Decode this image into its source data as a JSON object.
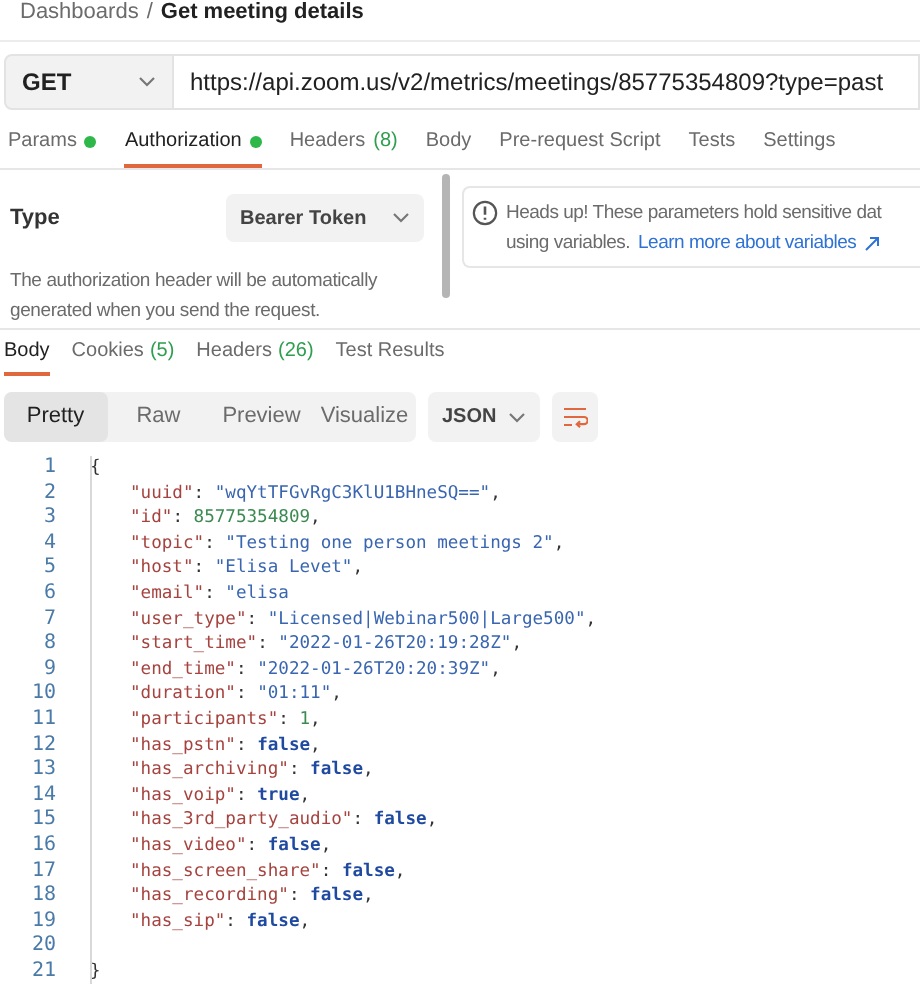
{
  "breadcrumb": {
    "parent": "Dashboards",
    "separator": "/",
    "current": "Get meeting details"
  },
  "request": {
    "method": "GET",
    "url": "https://api.zoom.us/v2/metrics/meetings/85775354809?type=past"
  },
  "request_tabs": [
    {
      "label": "Params",
      "dot": true,
      "selected": false
    },
    {
      "label": "Authorization",
      "dot": true,
      "selected": true
    },
    {
      "label": "Headers",
      "count": "(8)",
      "dot": false,
      "selected": false
    },
    {
      "label": "Body",
      "dot": false,
      "selected": false
    },
    {
      "label": "Pre-request Script",
      "dot": false,
      "selected": false
    },
    {
      "label": "Tests",
      "dot": false,
      "selected": false
    },
    {
      "label": "Settings",
      "dot": false,
      "selected": false
    }
  ],
  "authorization": {
    "type_label": "Type",
    "type_value": "Bearer Token",
    "description": "The authorization header will be automatically generated when you send the request.",
    "notice": "Heads up! These parameters hold sensitive dat",
    "notice_line2": "using variables.",
    "notice_link": "Learn more about variables"
  },
  "response_tabs": [
    {
      "label": "Body",
      "selected": true
    },
    {
      "label": "Cookies",
      "count": "(5)",
      "selected": false
    },
    {
      "label": "Headers",
      "count": "(26)",
      "selected": false
    },
    {
      "label": "Test Results",
      "selected": false
    }
  ],
  "view_modes": [
    {
      "label": "Pretty",
      "selected": true
    },
    {
      "label": "Raw",
      "selected": false
    },
    {
      "label": "Preview",
      "selected": false
    },
    {
      "label": "Visualize",
      "selected": false
    }
  ],
  "format": "JSON",
  "code_lines": [
    {
      "number": "1",
      "tokens": [
        {
          "kind": "punct",
          "text": "{"
        }
      ]
    },
    {
      "number": "2",
      "tokens": [
        {
          "kind": "key",
          "text": "\"uuid\""
        },
        {
          "kind": "punct",
          "text": ": "
        },
        {
          "kind": "string",
          "text": "\"wqYtTFGvRgC3KlU1BHneSQ==\""
        },
        {
          "kind": "punct",
          "text": ","
        }
      ]
    },
    {
      "number": "3",
      "tokens": [
        {
          "kind": "key",
          "text": "\"id\""
        },
        {
          "kind": "punct",
          "text": ": "
        },
        {
          "kind": "number",
          "text": "85775354809"
        },
        {
          "kind": "punct",
          "text": ","
        }
      ]
    },
    {
      "number": "4",
      "tokens": [
        {
          "kind": "key",
          "text": "\"topic\""
        },
        {
          "kind": "punct",
          "text": ": "
        },
        {
          "kind": "string",
          "text": "\"Testing one person meetings 2\""
        },
        {
          "kind": "punct",
          "text": ","
        }
      ]
    },
    {
      "number": "5",
      "tokens": [
        {
          "kind": "key",
          "text": "\"host\""
        },
        {
          "kind": "punct",
          "text": ": "
        },
        {
          "kind": "string",
          "text": "\"Elisa Levet\""
        },
        {
          "kind": "punct",
          "text": ","
        }
      ]
    },
    {
      "number": "6",
      "tokens": [
        {
          "kind": "key",
          "text": "\"email\""
        },
        {
          "kind": "punct",
          "text": ": "
        },
        {
          "kind": "string",
          "text": "\"elisa"
        }
      ]
    },
    {
      "number": "7",
      "tokens": [
        {
          "kind": "key",
          "text": "\"user_type\""
        },
        {
          "kind": "punct",
          "text": ": "
        },
        {
          "kind": "string",
          "text": "\"Licensed|Webinar500|Large500\""
        },
        {
          "kind": "punct",
          "text": ","
        }
      ]
    },
    {
      "number": "8",
      "tokens": [
        {
          "kind": "key",
          "text": "\"start_time\""
        },
        {
          "kind": "punct",
          "text": ": "
        },
        {
          "kind": "string",
          "text": "\"2022-01-26T20:19:28Z\""
        },
        {
          "kind": "punct",
          "text": ","
        }
      ]
    },
    {
      "number": "9",
      "tokens": [
        {
          "kind": "key",
          "text": "\"end_time\""
        },
        {
          "kind": "punct",
          "text": ": "
        },
        {
          "kind": "string",
          "text": "\"2022-01-26T20:20:39Z\""
        },
        {
          "kind": "punct",
          "text": ","
        }
      ]
    },
    {
      "number": "10",
      "tokens": [
        {
          "kind": "key",
          "text": "\"duration\""
        },
        {
          "kind": "punct",
          "text": ": "
        },
        {
          "kind": "string",
          "text": "\"01:11\""
        },
        {
          "kind": "punct",
          "text": ","
        }
      ]
    },
    {
      "number": "11",
      "tokens": [
        {
          "kind": "key",
          "text": "\"participants\""
        },
        {
          "kind": "punct",
          "text": ": "
        },
        {
          "kind": "number",
          "text": "1"
        },
        {
          "kind": "punct",
          "text": ","
        }
      ]
    },
    {
      "number": "12",
      "tokens": [
        {
          "kind": "key",
          "text": "\"has_pstn\""
        },
        {
          "kind": "punct",
          "text": ": "
        },
        {
          "kind": "boolean",
          "text": "false"
        },
        {
          "kind": "punct",
          "text": ","
        }
      ]
    },
    {
      "number": "13",
      "tokens": [
        {
          "kind": "key",
          "text": "\"has_archiving\""
        },
        {
          "kind": "punct",
          "text": ": "
        },
        {
          "kind": "boolean",
          "text": "false"
        },
        {
          "kind": "punct",
          "text": ","
        }
      ]
    },
    {
      "number": "14",
      "tokens": [
        {
          "kind": "key",
          "text": "\"has_voip\""
        },
        {
          "kind": "punct",
          "text": ": "
        },
        {
          "kind": "boolean",
          "text": "true"
        },
        {
          "kind": "punct",
          "text": ","
        }
      ]
    },
    {
      "number": "15",
      "tokens": [
        {
          "kind": "key",
          "text": "\"has_3rd_party_audio\""
        },
        {
          "kind": "punct",
          "text": ": "
        },
        {
          "kind": "boolean",
          "text": "false"
        },
        {
          "kind": "punct",
          "text": ","
        }
      ]
    },
    {
      "number": "16",
      "tokens": [
        {
          "kind": "key",
          "text": "\"has_video\""
        },
        {
          "kind": "punct",
          "text": ": "
        },
        {
          "kind": "boolean",
          "text": "false"
        },
        {
          "kind": "punct",
          "text": ","
        }
      ]
    },
    {
      "number": "17",
      "tokens": [
        {
          "kind": "key",
          "text": "\"has_screen_share\""
        },
        {
          "kind": "punct",
          "text": ": "
        },
        {
          "kind": "boolean",
          "text": "false"
        },
        {
          "kind": "punct",
          "text": ","
        }
      ]
    },
    {
      "number": "18",
      "tokens": [
        {
          "kind": "key",
          "text": "\"has_recording\""
        },
        {
          "kind": "punct",
          "text": ": "
        },
        {
          "kind": "boolean",
          "text": "false"
        },
        {
          "kind": "punct",
          "text": ","
        }
      ]
    },
    {
      "number": "19",
      "tokens": [
        {
          "kind": "key",
          "text": "\"has_sip\""
        },
        {
          "kind": "punct",
          "text": ": "
        },
        {
          "kind": "boolean",
          "text": "false"
        },
        {
          "kind": "punct",
          "text": ","
        }
      ]
    },
    {
      "number": "20"
    },
    {
      "number": "21",
      "tokens": [
        {
          "kind": "punct",
          "text": "}"
        }
      ]
    }
  ]
}
